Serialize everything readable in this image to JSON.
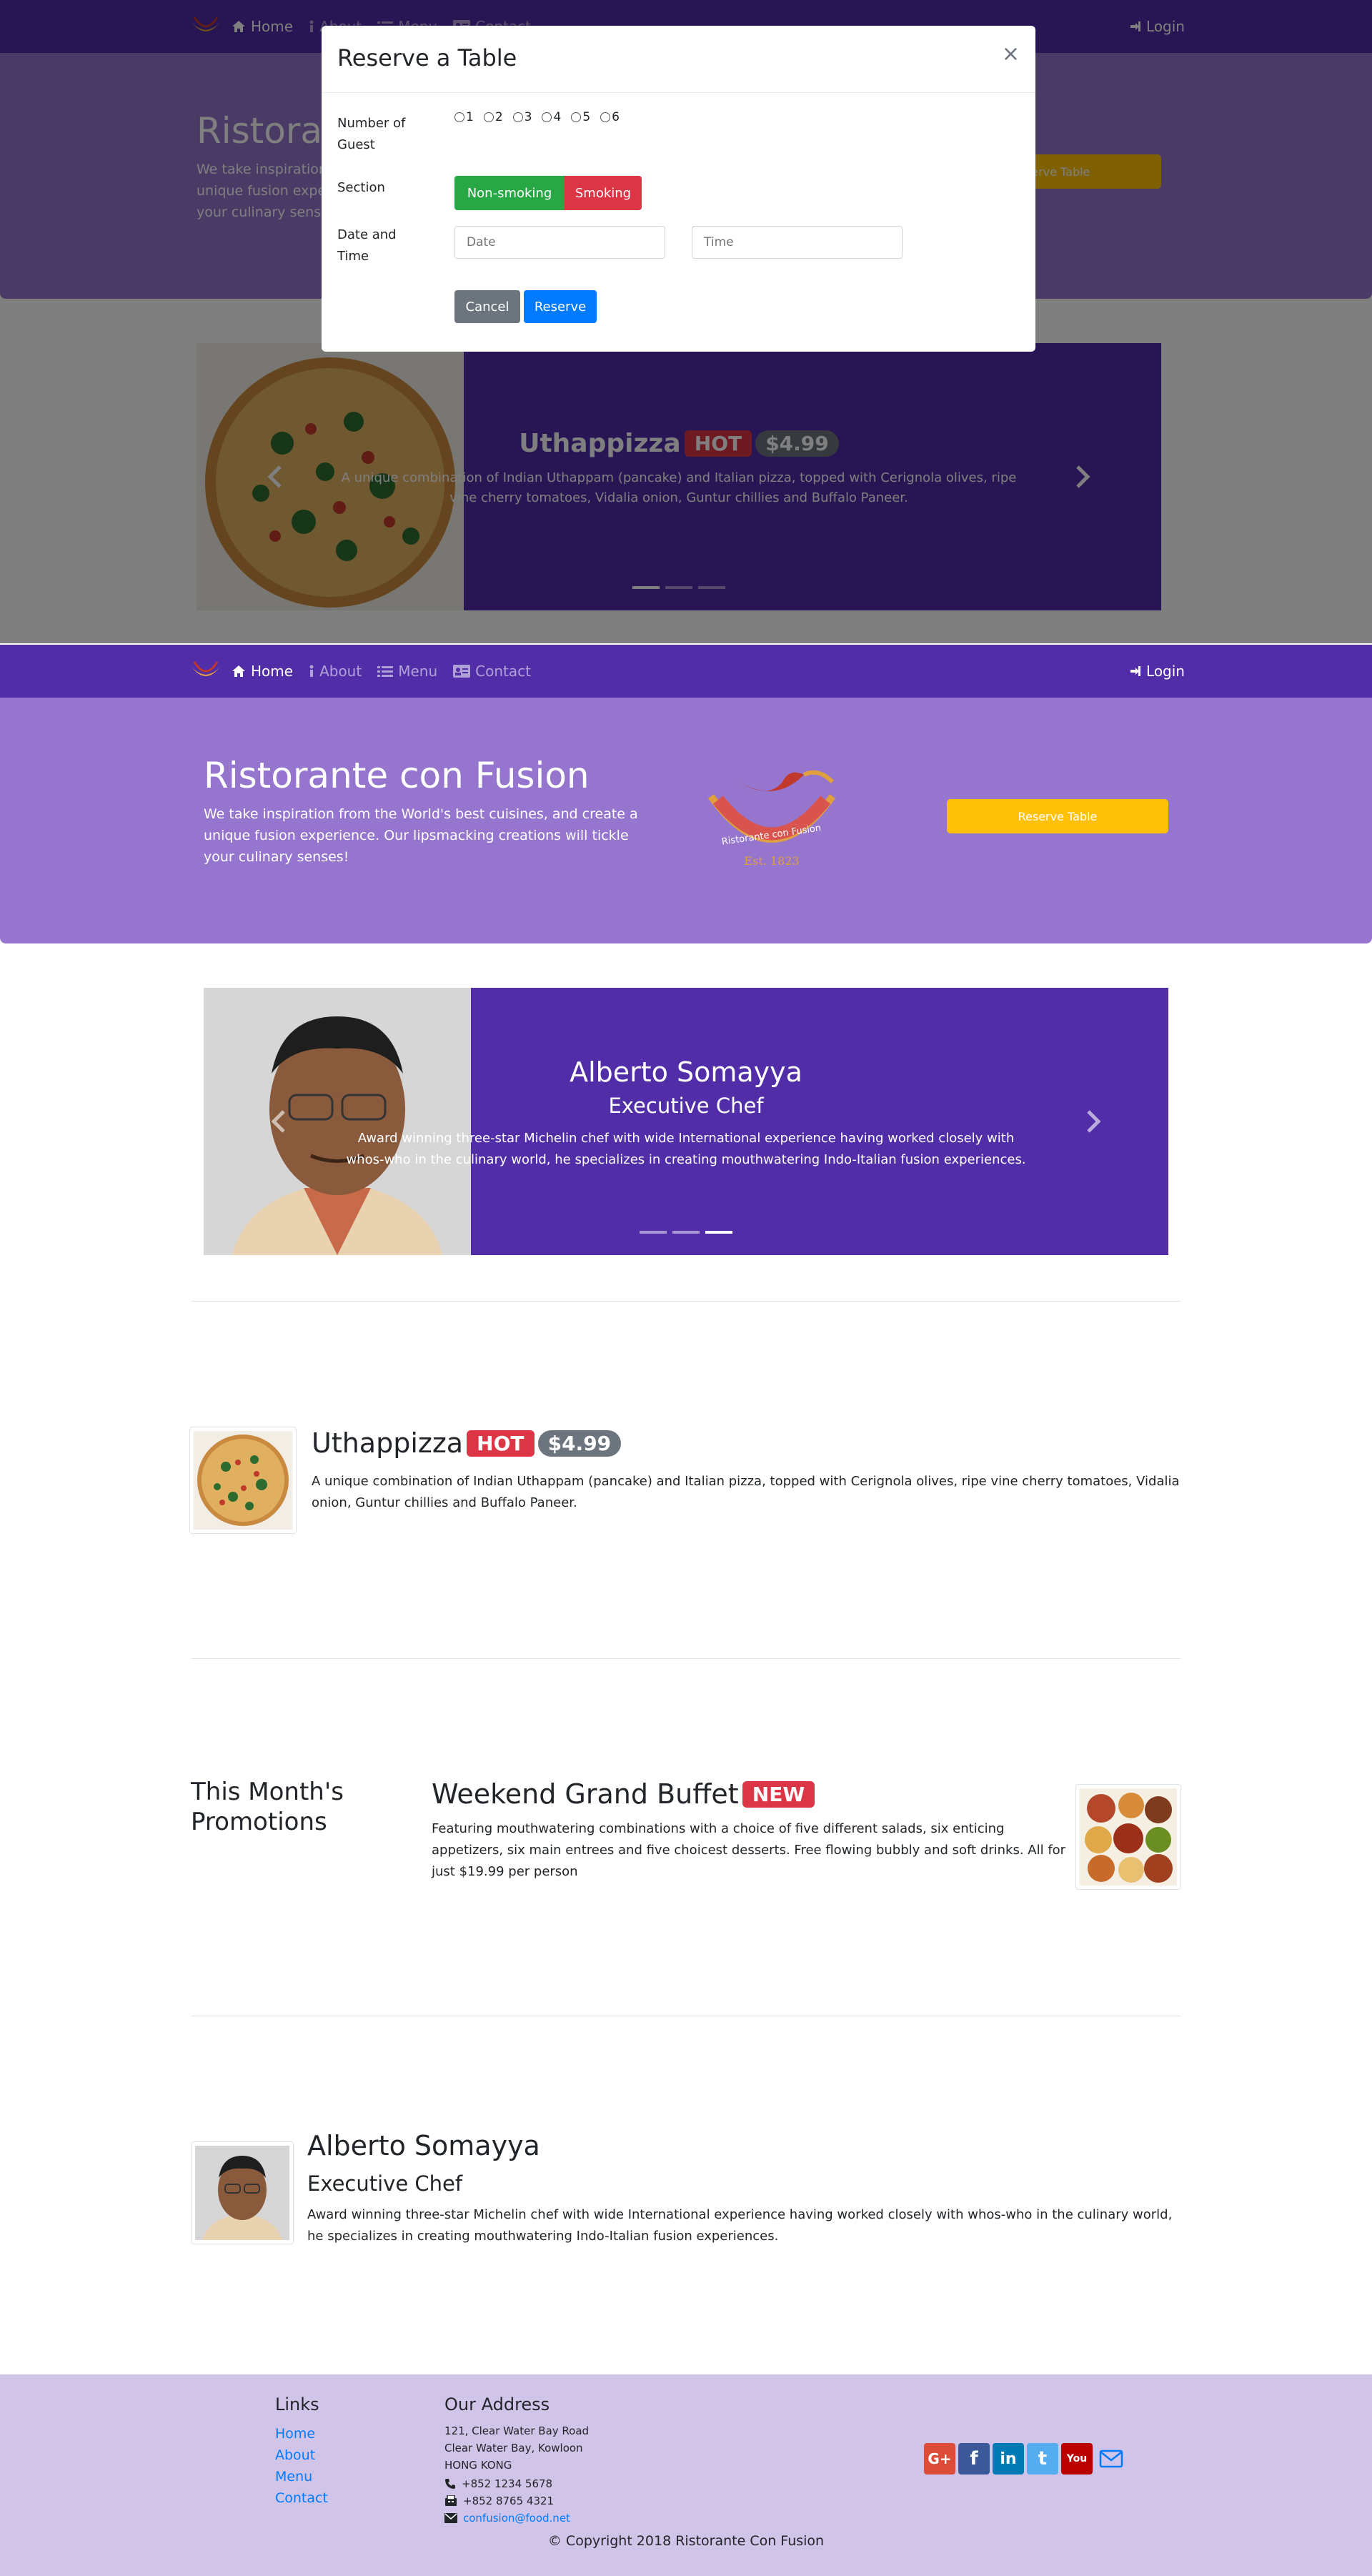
{
  "colors": {
    "primary": "#512DA8",
    "jumbotron": "#9575CD",
    "footer": "#D1C4E9",
    "warning": "#FFC107",
    "hot_badge": "#dc3545",
    "success": "#28a745",
    "button_blue": "#007bff"
  },
  "navbar": {
    "items": [
      {
        "label": "Home",
        "icon": "home-icon",
        "active": true
      },
      {
        "label": "About",
        "icon": "info-icon",
        "active": false
      },
      {
        "label": "Menu",
        "icon": "list-icon",
        "active": false
      },
      {
        "label": "Contact",
        "icon": "address-card-icon",
        "active": false
      }
    ],
    "login": "Login"
  },
  "jumbotron": {
    "title": "Ristorante con Fusion",
    "text": "We take inspiration from the World's best cuisines, and create a unique fusion experience. Our lipsmacking creations will tickle your culinary senses!",
    "logo_text": "Ristorante con Fusion",
    "logo_est": "Est. 1823",
    "reserve_button": "Reserve Table"
  },
  "modal": {
    "title": "Reserve a Table",
    "close": "×",
    "guests_label": "Number of Guest",
    "guest_options": [
      "1",
      "2",
      "3",
      "4",
      "5",
      "6"
    ],
    "section_label": "Section",
    "section_options": [
      "Non-smoking",
      "Smoking"
    ],
    "datetime_label": "Date and Time",
    "date_placeholder": "Date",
    "time_placeholder": "Time",
    "cancel": "Cancel",
    "reserve": "Reserve"
  },
  "background_carousel": {
    "name": "Uthappizza",
    "badge": "HOT",
    "price": "$4.99",
    "description": "A unique combination of Indian Uthappam (pancake) and Italian pizza, topped with Cerignola olives, ripe vine cherry tomatoes, Vidalia onion, Guntur chillies and Buffalo Paneer."
  },
  "carousel": {
    "name": "Alberto Somayya",
    "designation": "Executive Chef",
    "description": "Award winning three-star Michelin chef with wide International experience having worked closely with whos-who in the culinary world, he specializes in creating mouthwatering Indo-Italian fusion experiences.",
    "active_slide": 3,
    "slide_count": 3
  },
  "dish": {
    "name": "Uthappizza",
    "badge": "HOT",
    "price": "$4.99",
    "description": "A unique combination of Indian Uthappam (pancake) and Italian pizza, topped with Cerignola olives, ripe vine cherry tomatoes, Vidalia onion, Guntur chillies and Buffalo Paneer."
  },
  "promotion": {
    "section_heading": "This Month's Promotions",
    "name": "Weekend Grand Buffet",
    "badge": "NEW",
    "description": "Featuring mouthwatering combinations with a choice of five different salads, six enticing appetizers, six main entrees and five choicest desserts. Free flowing bubbly and soft drinks. All for just $19.99 per person"
  },
  "leader": {
    "name": "Alberto Somayya",
    "designation": "Executive Chef",
    "description": "Award winning three-star Michelin chef with wide International experience having worked closely with whos-who in the culinary world, he specializes in creating mouthwatering Indo-Italian fusion experiences."
  },
  "footer": {
    "links_heading": "Links",
    "links": [
      "Home",
      "About",
      "Menu",
      "Contact"
    ],
    "address_heading": "Our Address",
    "address_lines": [
      "121, Clear Water Bay Road",
      "Clear Water Bay, Kowloon",
      "HONG KONG"
    ],
    "phone": "+852 1234 5678",
    "fax": "+852 8765 4321",
    "email": "confusion@food.net",
    "copyright": "© Copyright 2018 Ristorante Con Fusion",
    "social": [
      {
        "icon": "google-plus-icon",
        "label": "G+",
        "color": "#dd4b39"
      },
      {
        "icon": "facebook-icon",
        "label": "f",
        "color": "#3b5998"
      },
      {
        "icon": "linkedin-icon",
        "label": "in",
        "color": "#007bb6"
      },
      {
        "icon": "twitter-icon",
        "label": "t",
        "color": "#55acee"
      },
      {
        "icon": "youtube-icon",
        "label": "You",
        "color": "#bb0000"
      },
      {
        "icon": "mail-icon",
        "label": "",
        "color": ""
      }
    ]
  }
}
